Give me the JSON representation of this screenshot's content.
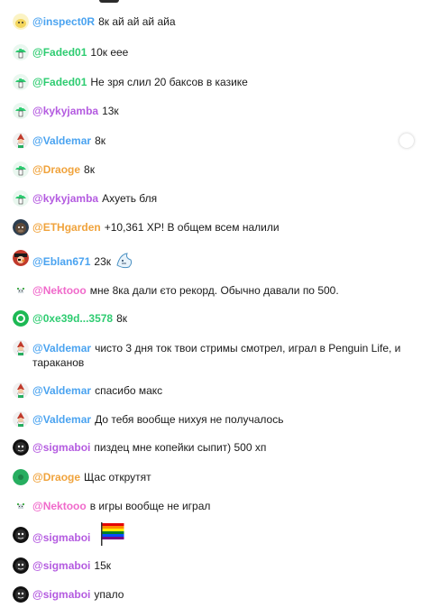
{
  "colors": {
    "pink": "#f06acb",
    "blue": "#4aa3f0",
    "green": "#2ecc71",
    "orange": "#f0a33c",
    "purple": "#b45be0"
  },
  "messages": [
    {
      "user": "@inspect0R",
      "text": "8к ай ай ай айа",
      "color": "#4aa3f0",
      "avatar": "blob-yellow"
    },
    {
      "user": "@Faded01",
      "text": "10к еее",
      "color": "#2ecc71",
      "avatar": "mushroom-green"
    },
    {
      "user": "@Faded01",
      "text": "Не зря слил 20 баксов в казике",
      "color": "#2ecc71",
      "avatar": "mushroom-green"
    },
    {
      "user": "@kykyjamba",
      "text": "13к",
      "color": "#b45be0",
      "avatar": "mushroom-green"
    },
    {
      "user": "@Valdemar",
      "text": "8к",
      "color": "#4aa3f0",
      "avatar": "gnome-santa"
    },
    {
      "user": "@Draoge",
      "text": "8к",
      "color": "#f0a33c",
      "avatar": "mushroom-green"
    },
    {
      "user": "@kykyjamba",
      "text": "Ахуеть бля",
      "color": "#b45be0",
      "avatar": "mushroom-green"
    },
    {
      "user": "@ETHgarden",
      "text": "+10,361 XP! В общем всем налили",
      "color": "#f0a33c",
      "avatar": "gorilla"
    },
    {
      "user": "@Eblan671",
      "text": "23к",
      "color": "#4aa3f0",
      "avatar": "pirate",
      "sticker": "shark-sticker"
    },
    {
      "user": "@Nektooo",
      "text": "мне 8ка дали єто рекорд. Обычно давали по 500.",
      "color": "#f06acb",
      "avatar": "pixel-critter"
    },
    {
      "user": "@0xe39d...3578",
      "text": "8к",
      "color": "#2ecc71",
      "avatar": "green-blob"
    },
    {
      "user": "@Valdemar",
      "text": "чисто 3 дня ток твои стримы смотрел, играл в Penguin Life, и тараканов",
      "color": "#4aa3f0",
      "avatar": "gnome-santa"
    },
    {
      "user": "@Valdemar",
      "text": "спасибо макс",
      "color": "#4aa3f0",
      "avatar": "gnome-santa"
    },
    {
      "user": "@Valdemar",
      "text": "До тебя вообще нихуя не получалось",
      "color": "#4aa3f0",
      "avatar": "gnome-santa"
    },
    {
      "user": "@sigmaboi",
      "text": "пиздец мне копейки сыпит) 500 хп",
      "color": "#b45be0",
      "avatar": "dark-face"
    },
    {
      "user": "@Draoge",
      "text": "Щас открутят",
      "color": "#f0a33c",
      "avatar": "green-disc"
    },
    {
      "user": "@Nektooo",
      "text": "в игры вообще не играл",
      "color": "#f06acb",
      "avatar": "pixel-critter"
    },
    {
      "user": "@sigmaboi",
      "text": "",
      "color": "#b45be0",
      "avatar": "dark-face",
      "sticker": "rainbow-flag"
    },
    {
      "user": "@sigmaboi",
      "text": "15к",
      "color": "#b45be0",
      "avatar": "dark-face"
    },
    {
      "user": "@sigmaboi",
      "text": "упало",
      "color": "#b45be0",
      "avatar": "dark-face"
    }
  ]
}
